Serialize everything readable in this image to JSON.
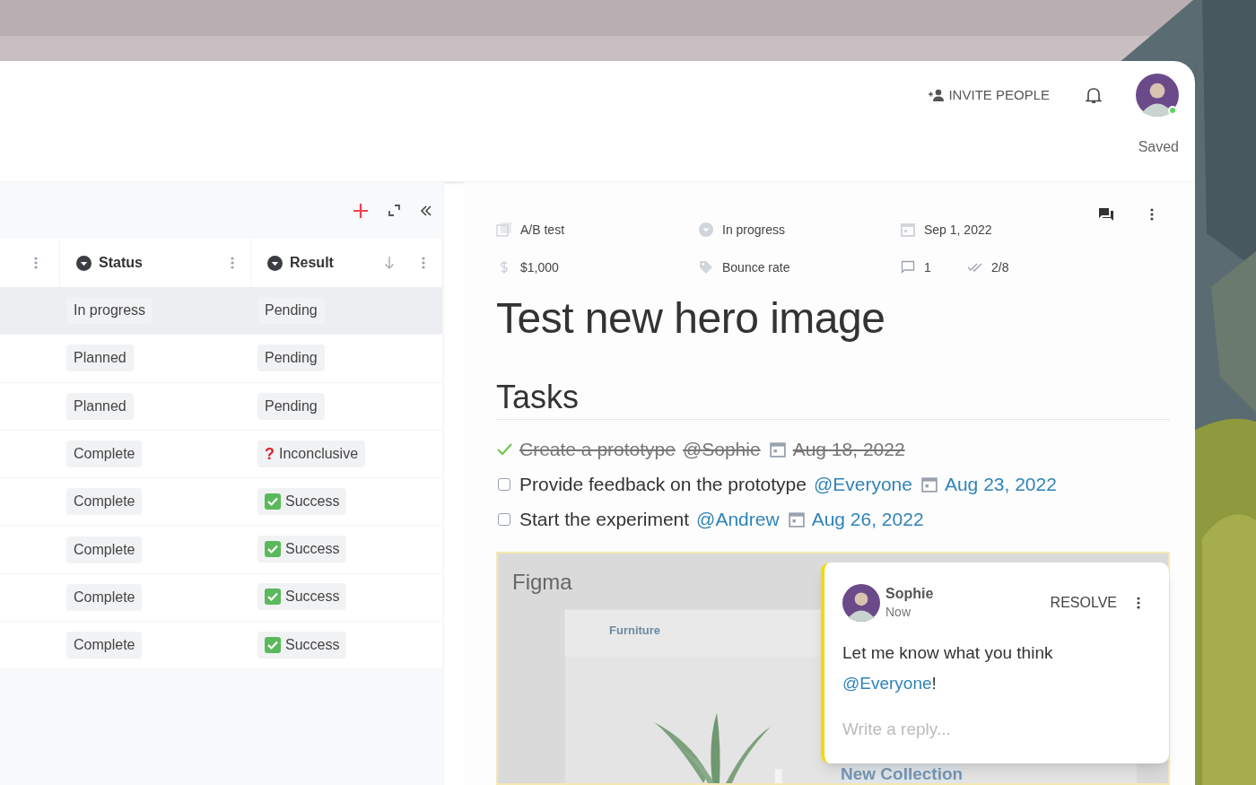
{
  "header": {
    "invite_label": "INVITE PEOPLE",
    "user_online": true,
    "save_status": "Saved"
  },
  "table": {
    "columns": [
      {
        "label": "Status",
        "sorted": false
      },
      {
        "label": "Result",
        "sorted": true
      }
    ],
    "rows": [
      {
        "status": "In progress",
        "result": {
          "kind": "plain",
          "text": "Pending"
        },
        "highlighted": true
      },
      {
        "status": "Planned",
        "result": {
          "kind": "plain",
          "text": "Pending"
        },
        "highlighted": false
      },
      {
        "status": "Planned",
        "result": {
          "kind": "plain",
          "text": "Pending"
        },
        "highlighted": false
      },
      {
        "status": "Complete",
        "result": {
          "kind": "question",
          "mark": "?",
          "text": "Inconclusive"
        },
        "highlighted": false
      },
      {
        "status": "Complete",
        "result": {
          "kind": "success",
          "text": "Success"
        },
        "highlighted": false
      },
      {
        "status": "Complete",
        "result": {
          "kind": "success",
          "text": "Success"
        },
        "highlighted": false
      },
      {
        "status": "Complete",
        "result": {
          "kind": "success",
          "text": "Success"
        },
        "highlighted": false
      },
      {
        "status": "Complete",
        "result": {
          "kind": "success",
          "text": "Success"
        },
        "highlighted": false
      }
    ]
  },
  "properties": [
    [
      {
        "kind": "type",
        "value": "A/B test"
      },
      {
        "kind": "status",
        "value": "In progress"
      },
      {
        "kind": "date",
        "value": "Sep 1, 2022"
      }
    ],
    [
      {
        "kind": "budget",
        "value": "$1,000"
      },
      {
        "kind": "tag",
        "value": "Bounce rate"
      },
      {
        "kind": "comments",
        "value": "1"
      },
      {
        "kind": "subtasks",
        "value": "2/8"
      }
    ]
  ],
  "title": "Test new hero image",
  "tasks_heading": "Tasks",
  "tasks": [
    {
      "text": "Create a prototype",
      "mention": "@Sophie",
      "date": "Aug 18, 2022",
      "done": true
    },
    {
      "text": "Provide feedback on the prototype",
      "mention": "@Everyone",
      "date": "Aug 23, 2022",
      "done": false
    },
    {
      "text": "Start the experiment",
      "mention": "@Andrew",
      "date": "Aug 26, 2022",
      "done": false
    }
  ],
  "embed": {
    "app": "Figma",
    "nav_item": "Furniture",
    "heading": "New Collection"
  },
  "comment": {
    "author": "Sophie",
    "time": "Now",
    "action": "RESOLVE",
    "text": "Let me know what you think",
    "mention": "@Everyone",
    "suffix": "!",
    "reply_placeholder": "Write a reply..."
  }
}
